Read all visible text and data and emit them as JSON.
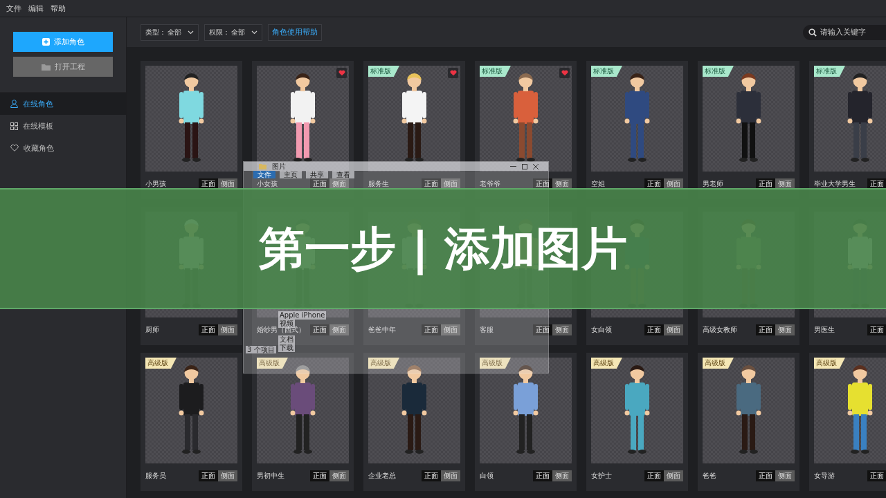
{
  "menu": [
    "文件",
    "编辑",
    "帮助"
  ],
  "sidebar": {
    "primary_button": "添加角色",
    "secondary_button": "打开工程",
    "items": [
      {
        "label": "在线角色",
        "selected": true
      },
      {
        "label": "在线模板",
        "selected": false
      },
      {
        "label": "收藏角色",
        "selected": false
      }
    ]
  },
  "toolbar": {
    "filters": [
      {
        "label": "类型：",
        "value": "全部"
      },
      {
        "label": "权限：",
        "value": "全部"
      }
    ],
    "help_button": "角色使用帮助",
    "search": {
      "placeholder": "请输入关键字"
    }
  },
  "cards": [
    {
      "name": "小男孩",
      "favorite": false,
      "views": [
        {
          "label": "正面",
          "selected": true
        },
        {
          "label": "侧面",
          "selected": false
        }
      ]
    },
    {
      "name": "小女孩",
      "favorite": true,
      "views": [
        {
          "label": "正面",
          "selected": true
        },
        {
          "label": "侧面",
          "selected": false
        }
      ]
    },
    {
      "name": "服务生",
      "badge": {
        "label": "标准版",
        "kind": "standard"
      },
      "favorite": true,
      "views": [
        {
          "label": "正面",
          "selected": true
        },
        {
          "label": "侧面",
          "selected": false
        }
      ]
    },
    {
      "name": "老爷爷",
      "badge": {
        "label": "标准版",
        "kind": "standard"
      },
      "favorite": true,
      "views": [
        {
          "label": "正面",
          "selected": true
        },
        {
          "label": "侧面",
          "selected": false
        }
      ]
    },
    {
      "name": "空姐",
      "badge": {
        "label": "标准版",
        "kind": "standard"
      },
      "favorite": false,
      "views": [
        {
          "label": "正面",
          "selected": true
        },
        {
          "label": "侧面",
          "selected": false
        }
      ]
    },
    {
      "name": "男老师",
      "badge": {
        "label": "标准版",
        "kind": "standard"
      },
      "favorite": false,
      "views": [
        {
          "label": "正面",
          "selected": true
        },
        {
          "label": "侧面",
          "selected": false
        }
      ]
    },
    {
      "name": "毕业大学男生",
      "badge": {
        "label": "标准版",
        "kind": "standard"
      },
      "favorite": false,
      "views": [
        {
          "label": "正面",
          "selected": true
        }
      ]
    },
    {
      "name": "厨师",
      "favorite": false,
      "views": [
        {
          "label": "正面",
          "selected": true
        },
        {
          "label": "侧面",
          "selected": false
        }
      ]
    },
    {
      "name": "婚纱男（西式）",
      "favorite": false,
      "views": [
        {
          "label": "正面",
          "selected": true
        },
        {
          "label": "侧面",
          "selected": false
        }
      ]
    },
    {
      "name": "爸爸中年",
      "favorite": false,
      "views": [
        {
          "label": "正面",
          "selected": true
        },
        {
          "label": "侧面",
          "selected": false
        }
      ]
    },
    {
      "name": "客服",
      "favorite": false,
      "views": [
        {
          "label": "正面",
          "selected": true
        },
        {
          "label": "侧面",
          "selected": false
        }
      ]
    },
    {
      "name": "女白领",
      "favorite": false,
      "views": [
        {
          "label": "正面",
          "selected": true
        },
        {
          "label": "侧面",
          "selected": false
        }
      ]
    },
    {
      "name": "高级女教师",
      "favorite": false,
      "views": [
        {
          "label": "正面",
          "selected": true
        },
        {
          "label": "侧面",
          "selected": false
        }
      ]
    },
    {
      "name": "男医生",
      "favorite": false,
      "views": [
        {
          "label": "正面",
          "selected": true
        }
      ]
    },
    {
      "name": "服务员",
      "badge": {
        "label": "高级版",
        "kind": "premium"
      },
      "favorite": false,
      "views": [
        {
          "label": "正面",
          "selected": true
        },
        {
          "label": "侧面",
          "selected": false
        }
      ]
    },
    {
      "name": "男初中生",
      "badge": {
        "label": "高级版",
        "kind": "premium"
      },
      "favorite": false,
      "views": [
        {
          "label": "正面",
          "selected": true
        },
        {
          "label": "侧面",
          "selected": false
        }
      ]
    },
    {
      "name": "企业老总",
      "badge": {
        "label": "高级版",
        "kind": "premium"
      },
      "favorite": false,
      "views": [
        {
          "label": "正面",
          "selected": true
        },
        {
          "label": "侧面",
          "selected": false
        }
      ]
    },
    {
      "name": "白领",
      "badge": {
        "label": "高级版",
        "kind": "premium"
      },
      "favorite": false,
      "views": [
        {
          "label": "正面",
          "selected": true
        },
        {
          "label": "侧面",
          "selected": false
        }
      ]
    },
    {
      "name": "女护士",
      "badge": {
        "label": "高级版",
        "kind": "premium"
      },
      "favorite": false,
      "views": [
        {
          "label": "正面",
          "selected": true
        },
        {
          "label": "侧面",
          "selected": false
        }
      ]
    },
    {
      "name": "爸爸",
      "badge": {
        "label": "高级版",
        "kind": "premium"
      },
      "favorite": false,
      "views": [
        {
          "label": "正面",
          "selected": true
        },
        {
          "label": "侧面",
          "selected": false
        }
      ]
    },
    {
      "name": "女导游",
      "badge": {
        "label": "高级版",
        "kind": "premium"
      },
      "favorite": false,
      "views": [
        {
          "label": "正面",
          "selected": true
        }
      ]
    }
  ],
  "explorer_window": {
    "title": "图片",
    "ribbon_tabs": [
      {
        "label": "文件",
        "selected": true
      },
      {
        "label": "主页",
        "selected": false
      },
      {
        "label": "共享",
        "selected": false
      },
      {
        "label": "查看",
        "selected": false
      }
    ],
    "nav_items": [
      "Apple iPhone",
      "视频",
      "文档",
      "下载"
    ],
    "status": "3 个项目"
  },
  "banner": {
    "title": "第一步 | 添加图片"
  }
}
